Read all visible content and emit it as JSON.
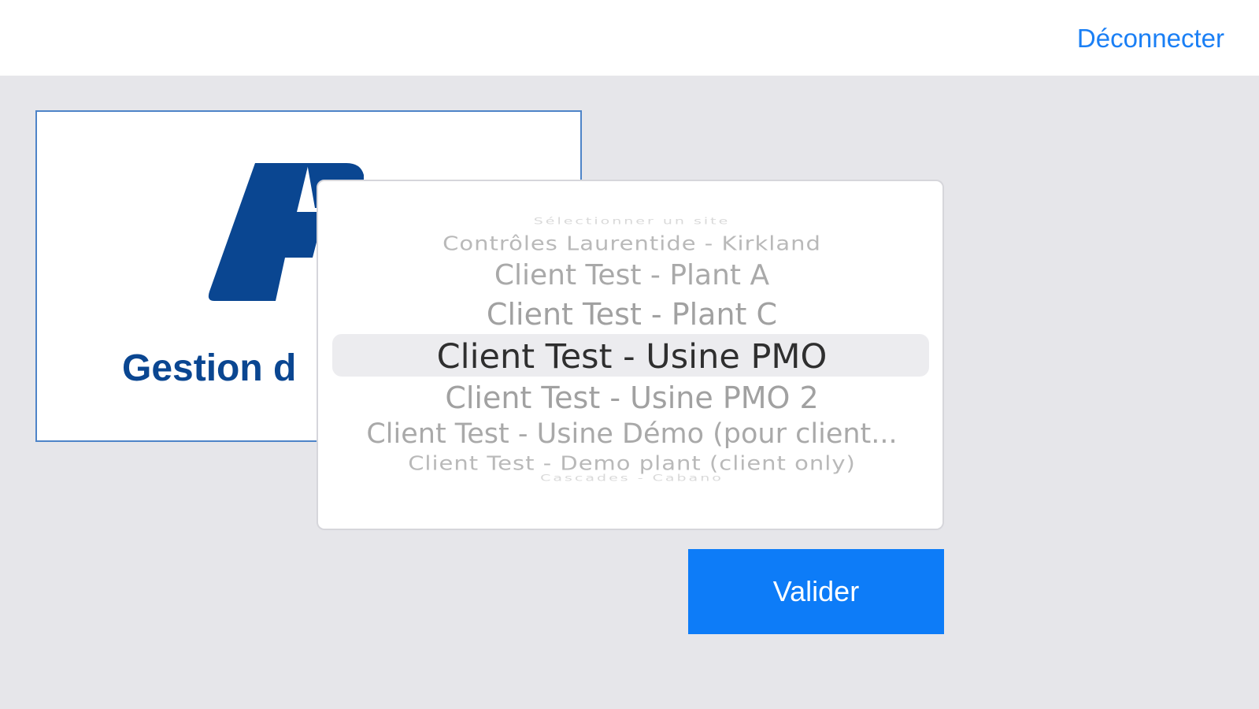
{
  "topbar": {
    "logout_label": "Déconnecter"
  },
  "app_card": {
    "title": "Gestion d",
    "logo_icon": "app-logo-icon",
    "brand_color": "#0a4691"
  },
  "site_picker": {
    "options": [
      "Sélectionner un site",
      "Contrôles Laurentide - Kirkland",
      "Client Test - Plant A",
      "Client Test - Plant C",
      "Client Test - Usine PMO",
      "Client Test - Usine PMO 2",
      "Client Test - Usine Démo (pour client...",
      "Client Test - Demo plant (client only)",
      "Cascades - Cabano"
    ],
    "selected": "Client Test - Usine PMO"
  },
  "actions": {
    "validate_label": "Valider",
    "accent_color": "#0d7cf8"
  }
}
